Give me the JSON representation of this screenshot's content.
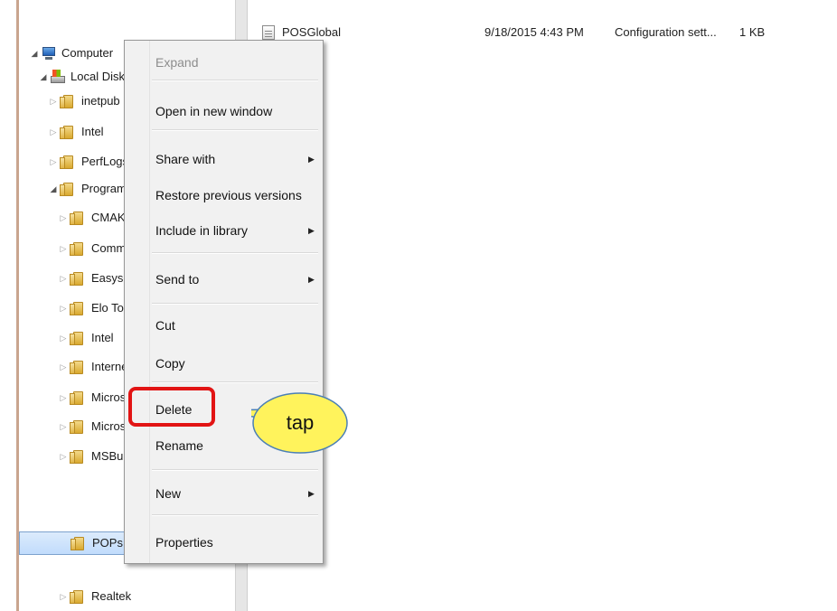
{
  "tree": {
    "computer": "Computer",
    "local_disk": "Local Disk (C",
    "inetpub": "inetpub",
    "intel": "Intel",
    "perflogs": "PerfLogs",
    "program_files": "Program F",
    "cmak": "CMAK",
    "common": "Commo",
    "easyset": "Easyset",
    "elo_touch": "Elo Touc",
    "intel2": "Intel",
    "internet": "Internet",
    "microsoft1": "Microso",
    "microsoft2": "Microso",
    "msbuild": "MSBuild",
    "pops_restaurant": "POPs Restaurant",
    "realtek": "Realtek"
  },
  "file": {
    "name": "POSGlobal",
    "date": "9/18/2015 4:43 PM",
    "type": "Configuration sett...",
    "size": "1 KB"
  },
  "context_menu": {
    "expand": "Expand",
    "open_new_window": "Open in new window",
    "share_with": "Share with",
    "restore_previous": "Restore previous versions",
    "include_library": "Include in library",
    "send_to": "Send to",
    "cut": "Cut",
    "copy": "Copy",
    "delete": "Delete",
    "rename": "Rename",
    "new": "New",
    "properties": "Properties"
  },
  "annotation": {
    "callout_text": "tap",
    "highlight_color": "#e21414",
    "callout_fill": "#fff35c",
    "callout_stroke": "#4a7fb5"
  },
  "colors": {
    "selected_row": "#c1dcfc",
    "menu_bg": "#f1f1f1"
  }
}
